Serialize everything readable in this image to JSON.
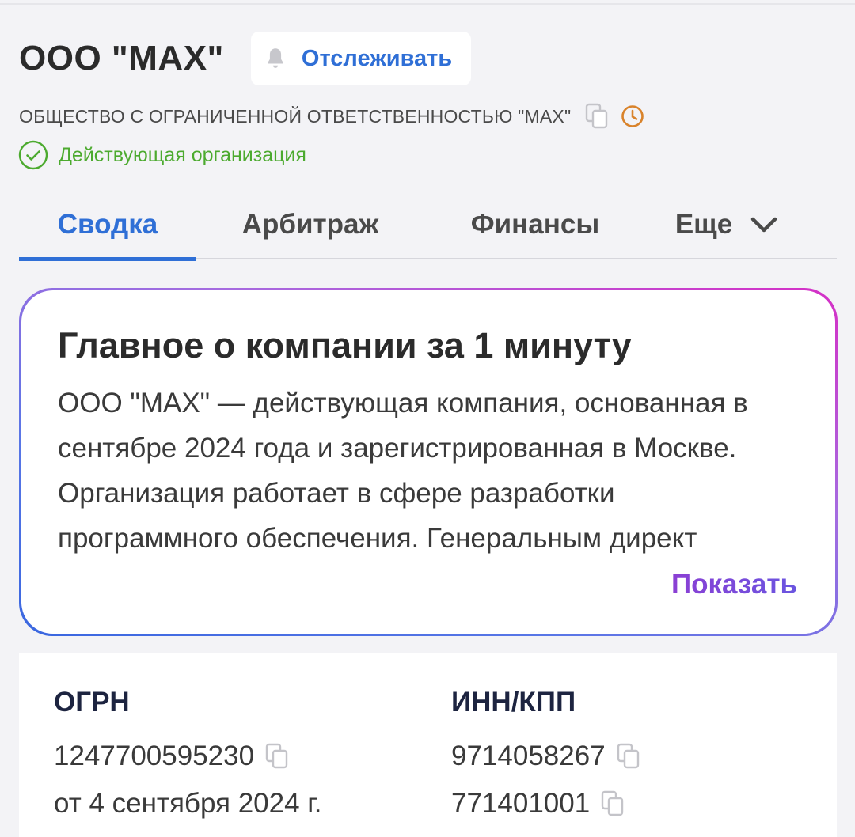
{
  "header": {
    "company_title": "ООО \"МАХ\"",
    "follow_label": "Отслеживать",
    "full_name": "ОБЩЕСТВО С ОГРАНИЧЕННОЙ ОТВЕТСТВЕННОСТЬЮ \"МАХ\"",
    "status": "Действующая организация"
  },
  "tabs": [
    {
      "label": "Сводка"
    },
    {
      "label": "Арбитраж"
    },
    {
      "label": "Финансы"
    },
    {
      "label": "Еще"
    }
  ],
  "summary": {
    "title": "Главное о компании за 1 минуту",
    "text": "ООО \"МАХ\" — действующая компания, основанная в сентябре 2024 года и зарегистрированная в Москве. Организация работает в сфере разработки программного обеспечения. Генеральным директ",
    "show_label": "Показать"
  },
  "ids": {
    "ogrn_label": "ОГРН",
    "ogrn_value": "1247700595230",
    "ogrn_date": "от 4 сентября 2024 г.",
    "inn_label": "ИНН/КПП",
    "inn_value": "9714058267",
    "kpp_value": "771401001"
  },
  "colors": {
    "accent": "#2f6fd6",
    "status_green": "#4caa2f",
    "clock_orange": "#d9832b",
    "show_purple": "#8b3fd4"
  },
  "icons": [
    "bell-icon",
    "copy-icon",
    "clock-icon",
    "check-circle-icon",
    "chevron-down-icon"
  ]
}
